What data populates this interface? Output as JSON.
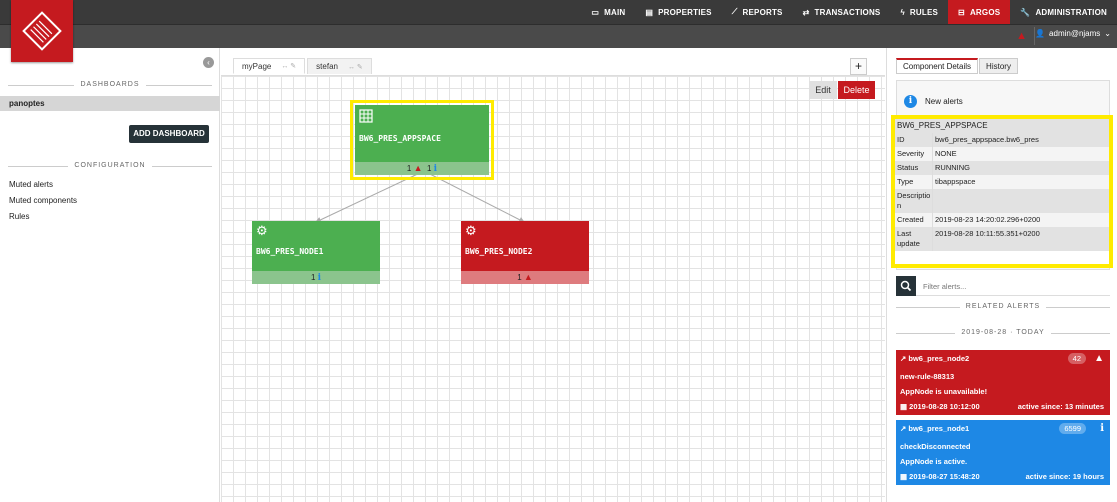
{
  "nav": {
    "items": [
      {
        "label": "MAIN",
        "icon": "monitor-icon",
        "glyph": "▭"
      },
      {
        "label": "PROPERTIES",
        "icon": "list-icon",
        "glyph": "▤"
      },
      {
        "label": "REPORTS",
        "icon": "chart-icon",
        "glyph": "⟋"
      },
      {
        "label": "TRANSACTIONS",
        "icon": "exchange-icon",
        "glyph": "⇄"
      },
      {
        "label": "RULES",
        "icon": "bolt-icon",
        "glyph": "ϟ"
      },
      {
        "label": "ARGOS",
        "icon": "argos-icon",
        "glyph": "⊟"
      },
      {
        "label": "ADMINISTRATION",
        "icon": "wrench-icon",
        "glyph": "🔧"
      }
    ],
    "active": "ARGOS",
    "user": "admin@njams"
  },
  "sidebar": {
    "dashboards_header": "DASHBOARDS",
    "dashboard_item": "panoptes",
    "add_dashboard": "ADD DASHBOARD",
    "configuration_header": "CONFIGURATION",
    "config_links": [
      "Muted alerts",
      "Muted components",
      "Rules"
    ]
  },
  "center": {
    "tabs": [
      {
        "label": "myPage",
        "active": true
      },
      {
        "label": "stefan",
        "active": false
      }
    ],
    "add_label": "+",
    "edit_label": "Edit",
    "delete_label": "Delete",
    "nodes": [
      {
        "name": "BW6_PRES_APPSPACE",
        "status": "green",
        "warn_count": "1",
        "info_count": "1"
      },
      {
        "name": "BW6_PRES_NODE1",
        "status": "green",
        "info_count": "1"
      },
      {
        "name": "BW6_PRES_NODE2",
        "status": "red",
        "warn_count": "1"
      }
    ]
  },
  "right": {
    "tabs": [
      "Component Details",
      "History"
    ],
    "new_alerts": "New alerts",
    "detail": {
      "title": "BW6_PRES_APPSPACE",
      "rows": [
        {
          "k": "ID",
          "v": "bw6_pres_appspace.bw6_pres"
        },
        {
          "k": "Severity",
          "v": "NONE"
        },
        {
          "k": "Status",
          "v": "RUNNING"
        },
        {
          "k": "Type",
          "v": "tibappspace"
        },
        {
          "k": "Descriptio n",
          "v": ""
        },
        {
          "k": "Created",
          "v": "2019-08-23 14:20:02.296+0200"
        },
        {
          "k": "Last update",
          "v": "2019-08-28 10:11:55.351+0200"
        }
      ]
    },
    "filter_placeholder": "Filter alerts...",
    "related_header": "RELATED ALERTS",
    "date_header": "2019-08-28  ·  TODAY",
    "alerts": [
      {
        "source": "bw6_pres_node2",
        "count": "42",
        "rule": "new-rule-88313",
        "message": "AppNode is unavailable!",
        "time": "2019-08-28 10:12:00",
        "since": "active since: 13 minutes",
        "color": "#c51a1f"
      },
      {
        "source": "bw6_pres_node1",
        "count": "6599",
        "rule": "checkDisconnected",
        "message": "AppNode is active.",
        "time": "2019-08-27 15:48:20",
        "since": "active since: 19 hours",
        "color": "#1e88e5"
      }
    ]
  },
  "colors": {
    "brand": "#c51a1f",
    "ok": "#4caf50",
    "info": "#1e88e5",
    "highlight": "#ffeb00"
  }
}
